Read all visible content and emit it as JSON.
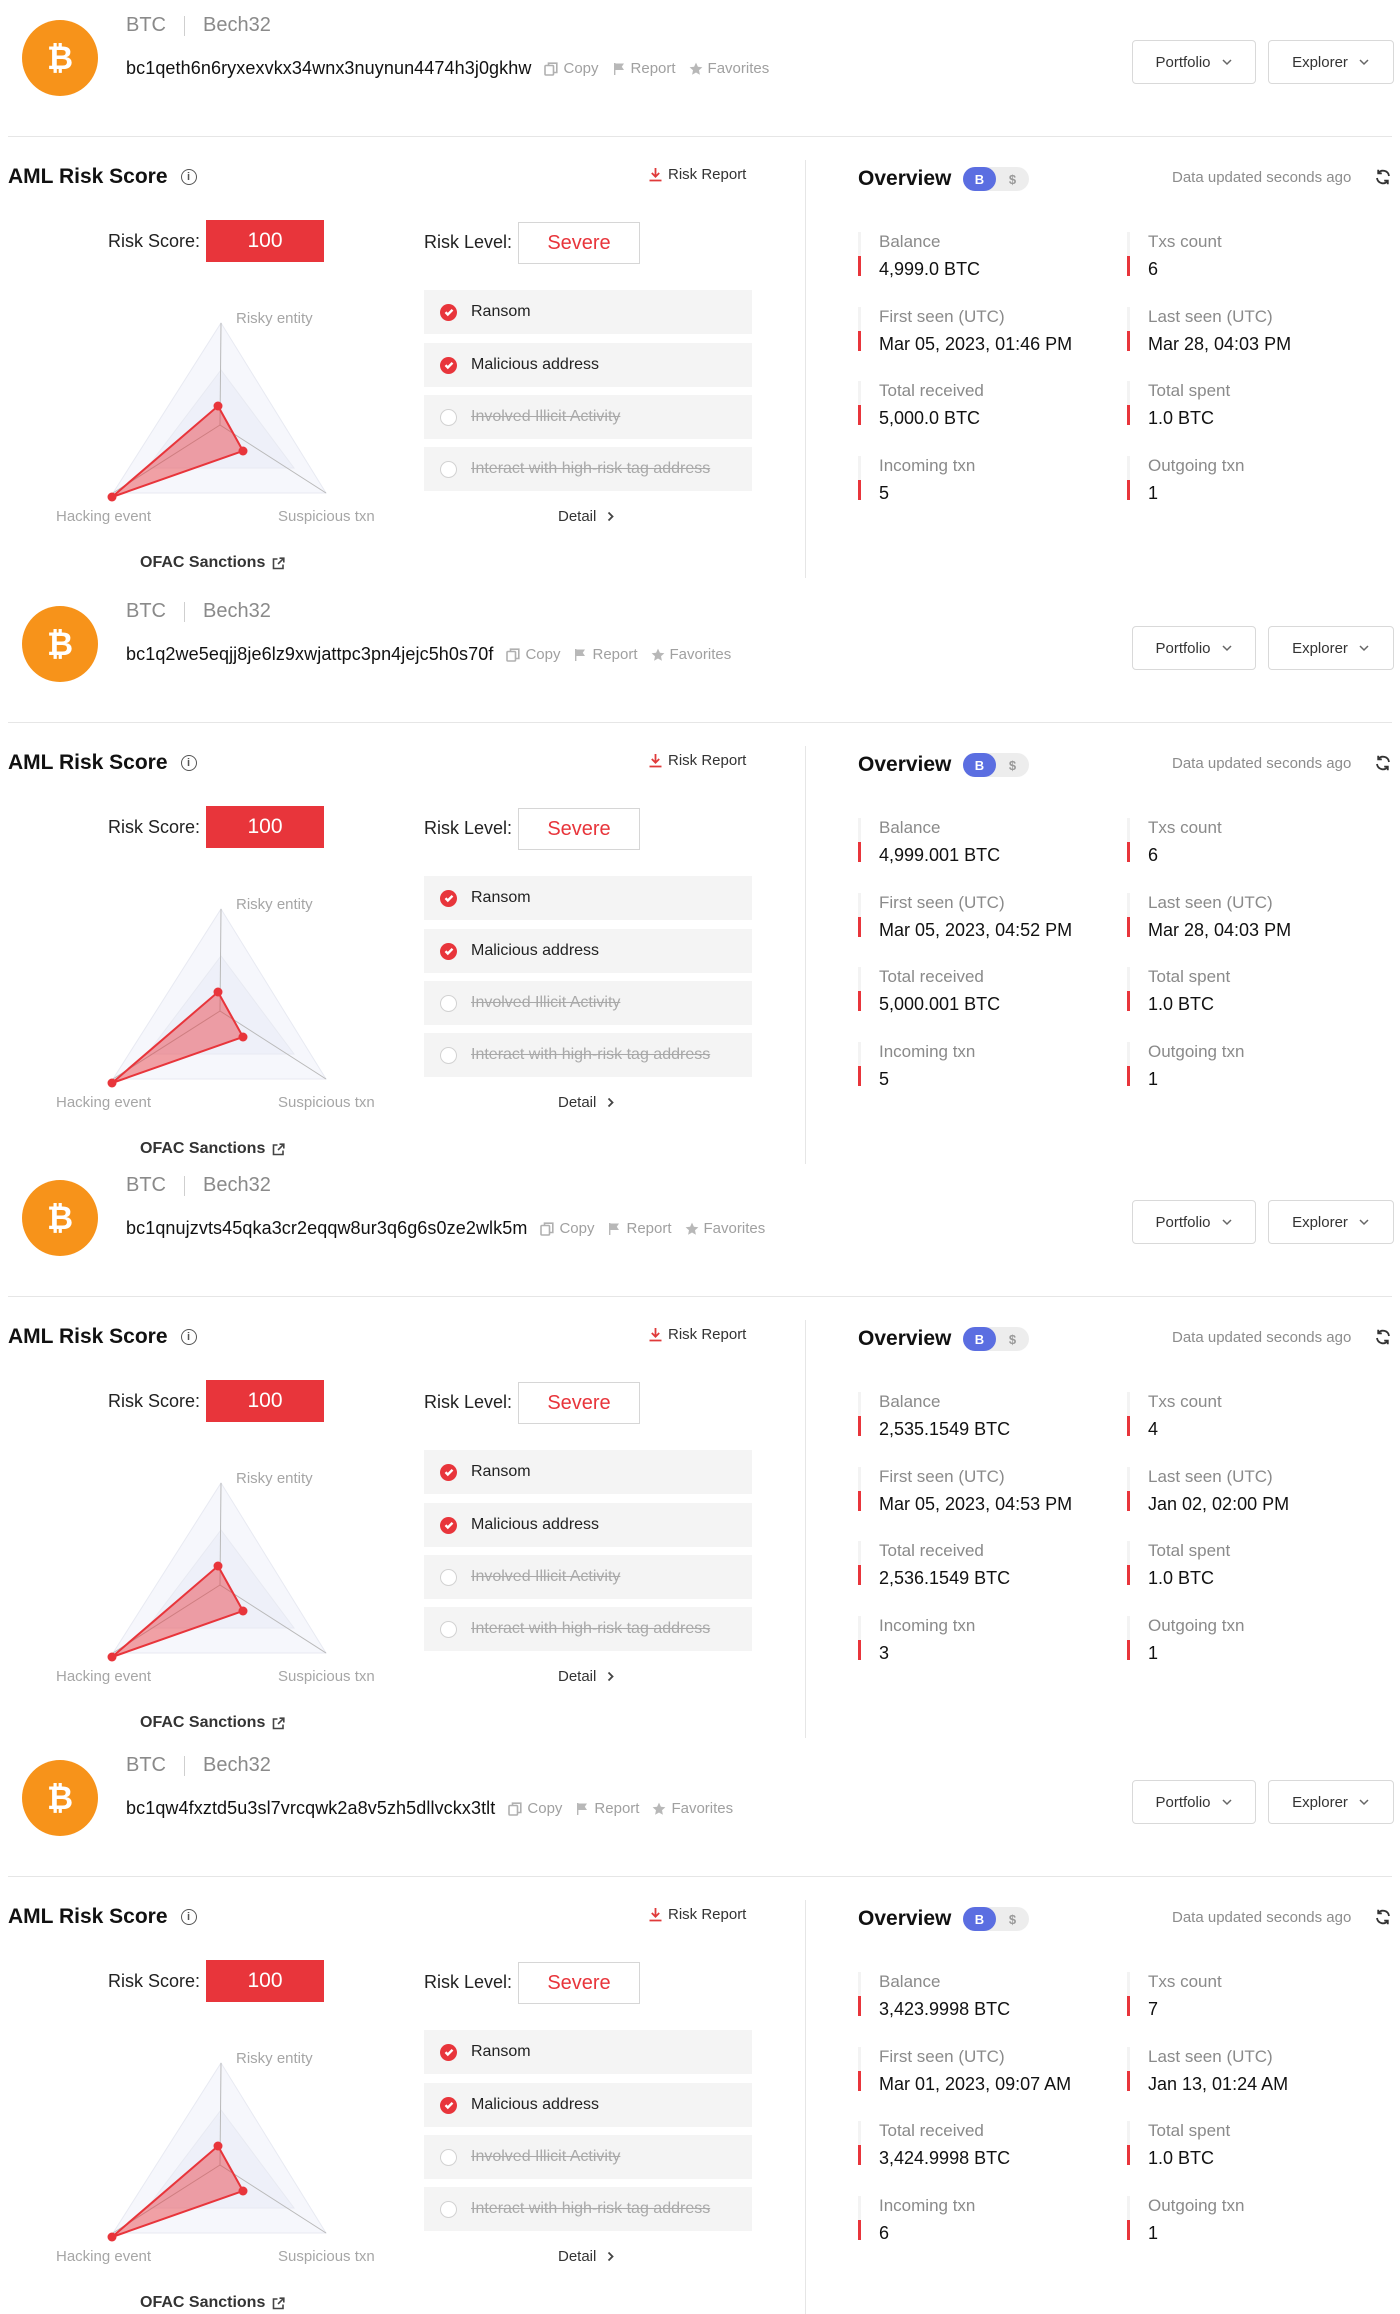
{
  "labels": {
    "copy": "Copy",
    "report": "Report",
    "favorites": "Favorites",
    "portfolio": "Portfolio",
    "explorer": "Explorer",
    "aml_title": "AML Risk Score",
    "risk_report": "Risk Report",
    "risk_score": "Risk Score:",
    "risk_level": "Risk Level:",
    "radar_risky": "Risky entity",
    "radar_hacking": "Hacking event",
    "radar_suspicious": "Suspicious txn",
    "ofac": "OFAC Sanctions",
    "detail": "Detail",
    "overview_title": "Overview",
    "updated": "Data updated seconds ago",
    "balance": "Balance",
    "txs_count": "Txs count",
    "first_seen": "First seen (UTC)",
    "last_seen": "Last seen (UTC)",
    "total_received": "Total received",
    "total_spent": "Total spent",
    "incoming": "Incoming txn",
    "outgoing": "Outgoing txn"
  },
  "icons": {
    "coin": "bitcoin-logo-icon",
    "copy": "copy-icon",
    "report": "flag-icon",
    "favorites": "star-icon",
    "dropdown": "chevron-down-icon",
    "info": "info-icon",
    "risk_report": "download-icon",
    "ofac": "external-link-icon",
    "detail": "chevron-right-icon",
    "refresh": "refresh-icon",
    "flag_on": "check-circle-icon"
  },
  "colors": {
    "brand_orange": "#f7931a",
    "danger_red": "#e8353b",
    "toggle_blue": "#5b6ee1"
  },
  "toggle": {
    "left": "B",
    "right": "$"
  },
  "flags": [
    {
      "label": "Ransom",
      "active": true
    },
    {
      "label": "Malicious address",
      "active": true
    },
    {
      "label": "Involved Illicit Activity",
      "active": false
    },
    {
      "label": "Interact with high-risk tag address",
      "active": false
    }
  ],
  "wallets": [
    {
      "chain": "BTC",
      "address_type": "Bech32",
      "address": "bc1qeth6n6ryxexvkx34wnx3nuynun4474h3j0gkhw",
      "risk_score": "100",
      "risk_level": "Severe",
      "stats": {
        "balance": "4,999.0 BTC",
        "txs_count": "6",
        "first_seen": "Mar 05, 2023, 01:46 PM",
        "last_seen": "Mar 28, 04:03 PM",
        "total_received": "5,000.0 BTC",
        "total_spent": "1.0 BTC",
        "incoming": "5",
        "outgoing": "1"
      }
    },
    {
      "chain": "BTC",
      "address_type": "Bech32",
      "address": "bc1q2we5eqjj8je6lz9xwjattpc3pn4jejc5h0s70f",
      "risk_score": "100",
      "risk_level": "Severe",
      "stats": {
        "balance": "4,999.001 BTC",
        "txs_count": "6",
        "first_seen": "Mar 05, 2023, 04:52 PM",
        "last_seen": "Mar 28, 04:03 PM",
        "total_received": "5,000.001 BTC",
        "total_spent": "1.0 BTC",
        "incoming": "5",
        "outgoing": "1"
      }
    },
    {
      "chain": "BTC",
      "address_type": "Bech32",
      "address": "bc1qnujzvts45qka3cr2eqqw8ur3q6g6s0ze2wlk5m",
      "risk_score": "100",
      "risk_level": "Severe",
      "stats": {
        "balance": "2,535.1549 BTC",
        "txs_count": "4",
        "first_seen": "Mar 05, 2023, 04:53 PM",
        "last_seen": "Jan 02, 02:00 PM",
        "total_received": "2,536.1549 BTC",
        "total_spent": "1.0 BTC",
        "incoming": "3",
        "outgoing": "1"
      }
    },
    {
      "chain": "BTC",
      "address_type": "Bech32",
      "address": "bc1qw4fxztd5u3sl7vrcqwk2a8v5zh5dllvckx3tlt",
      "risk_score": "100",
      "risk_level": "Severe",
      "stats": {
        "balance": "3,423.9998 BTC",
        "txs_count": "7",
        "first_seen": "Mar 01, 2023, 09:07 AM",
        "last_seen": "Jan 13, 01:24 AM",
        "total_received": "3,424.9998 BTC",
        "total_spent": "1.0 BTC",
        "incoming": "6",
        "outgoing": "1"
      }
    }
  ]
}
